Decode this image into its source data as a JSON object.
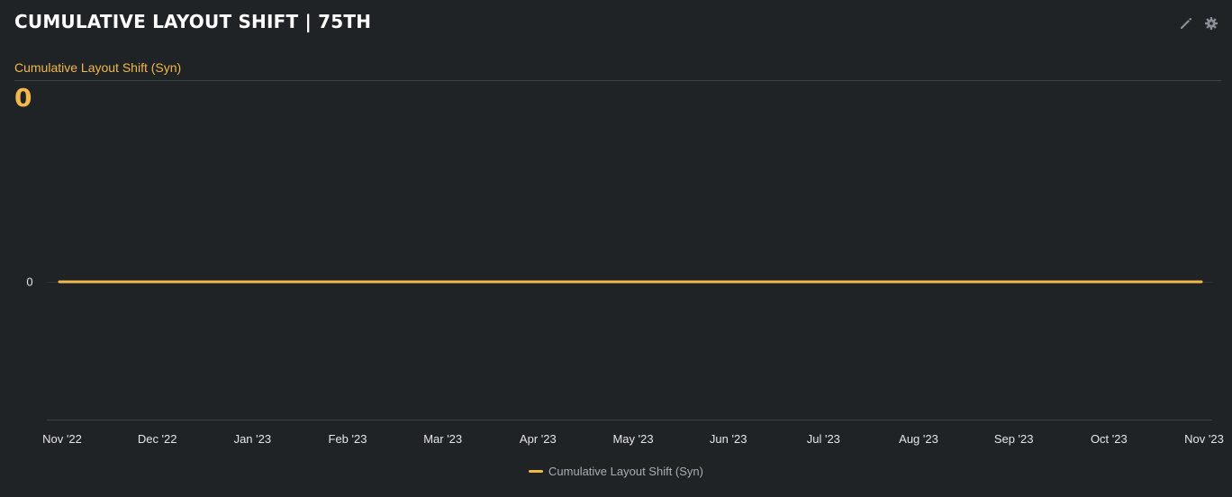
{
  "widget": {
    "title": "CUMULATIVE LAYOUT SHIFT | 75TH",
    "edit_icon": "pencil-icon",
    "settings_icon": "gear-icon",
    "metric_label": "Cumulative Layout Shift (Syn)",
    "metric_value": "0"
  },
  "colors": {
    "background": "#1f2326",
    "series": "#f2b84b",
    "axis_text": "#e6e6e6",
    "legend_text": "#a8adb2",
    "axis_line": "#3d4247"
  },
  "chart_data": {
    "type": "line",
    "title": "",
    "xlabel": "",
    "ylabel": "",
    "categories": [
      "Nov '22",
      "Dec '22",
      "Jan '23",
      "Feb '23",
      "Mar '23",
      "Apr '23",
      "May '23",
      "Jun '23",
      "Jul '23",
      "Aug '23",
      "Sep '23",
      "Oct '23",
      "Nov '23"
    ],
    "y_ticks": [
      "0"
    ],
    "ylim": [
      -1,
      1
    ],
    "series": [
      {
        "name": "Cumulative Layout Shift (Syn)",
        "color": "#f2b84b",
        "x": [
          "Nov '22",
          "Nov '23"
        ],
        "values": [
          0,
          0
        ]
      }
    ],
    "grid": false,
    "legend": "bottom-center"
  }
}
